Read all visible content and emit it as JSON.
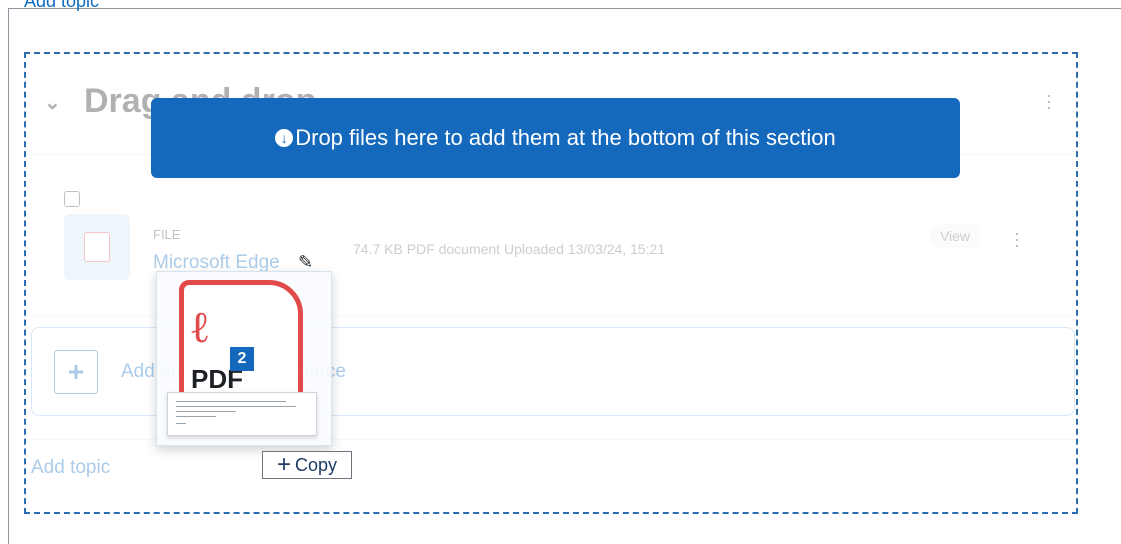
{
  "page": {
    "add_topic_top": "Add topic",
    "add_topic_bottom": "Add topic"
  },
  "section": {
    "title": "Drag and drop",
    "chevron_icon": "chevron-down-icon",
    "menu_icon": "kebab-menu-icon"
  },
  "drop_banner": {
    "icon": "download-circle-icon",
    "text": "Drop files here to add them at the bottom of this section"
  },
  "activity": {
    "type": "FILE",
    "name": "Microsoft Edge",
    "meta": "74.7 KB PDF document Uploaded 13/03/24, 15:21",
    "view_label": "View",
    "edit_icon": "pencil-icon",
    "menu_icon": "kebab-menu-icon"
  },
  "add_activity": {
    "label": "Add an activity or resource",
    "icon": "plus-icon"
  },
  "drag_ghost": {
    "pdf_label": "PDF",
    "count": "2",
    "copy_label": "Copy"
  },
  "colors": {
    "accent": "#0f6cbf",
    "banner": "#1469bc",
    "pdf_red": "#e24a4a"
  }
}
